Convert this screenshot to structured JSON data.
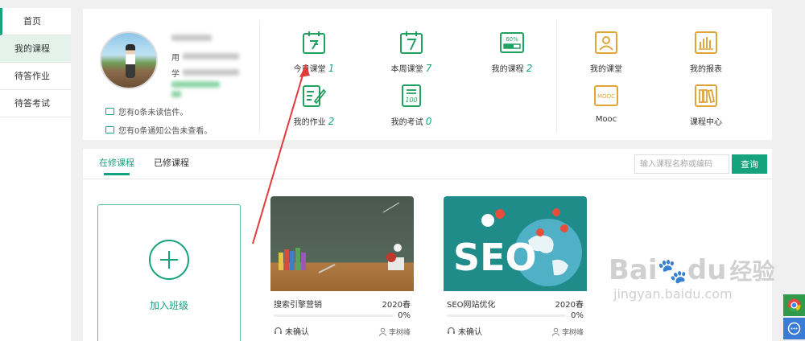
{
  "sidebar": {
    "items": [
      {
        "label": "首页"
      },
      {
        "label": "我的课程"
      },
      {
        "label": "待答作业"
      },
      {
        "label": "待答考试"
      }
    ]
  },
  "profile": {
    "name_label": "用",
    "school_label": "学",
    "mail_notice": "您有0条未读信件。",
    "announce_notice": "您有0条通知公告未查看。"
  },
  "stats": [
    {
      "label": "今日课堂",
      "count": "1",
      "icon": "clock-calendar-icon"
    },
    {
      "label": "本周课堂",
      "count": "7",
      "icon": "calendar-7-icon"
    },
    {
      "label": "我的课程",
      "count": "2",
      "icon": "progress-60-icon",
      "icon_text": "60%"
    },
    {
      "label": "我的作业",
      "count": "2",
      "icon": "homework-pencil-icon"
    },
    {
      "label": "我的考试",
      "count": "0",
      "icon": "exam-100-icon",
      "icon_text": "100"
    }
  ],
  "quick_links": [
    {
      "label": "我的课堂",
      "icon": "person-board-icon"
    },
    {
      "label": "我的报表",
      "icon": "bar-report-icon"
    },
    {
      "label": "Mooc",
      "icon": "mooc-icon",
      "icon_text": "MOOC"
    },
    {
      "label": "课程中心",
      "icon": "books-icon"
    }
  ],
  "tabs": [
    {
      "label": "在修课程"
    },
    {
      "label": "已修课程"
    }
  ],
  "search": {
    "placeholder": "输入课程名称或编码",
    "button": "查询"
  },
  "join_class": {
    "label": "加入班级"
  },
  "courses": [
    {
      "name": "搜索引擎营销",
      "term": "2020春",
      "progress": "0%",
      "status": "未确认",
      "teacher": "李树峰"
    },
    {
      "name": "SEO网站优化",
      "term": "2020春",
      "progress": "0%",
      "status": "未确认",
      "teacher": "李树峰",
      "cover_text": "SEO"
    }
  ],
  "watermark": {
    "brand": "Bai",
    "brand2": "du",
    "brand_cn": "经验",
    "url": "jingyan.baidu.com"
  },
  "colors": {
    "accent": "#14a37d",
    "icon_green": "#22a060",
    "icon_orange": "#e0a53a"
  }
}
